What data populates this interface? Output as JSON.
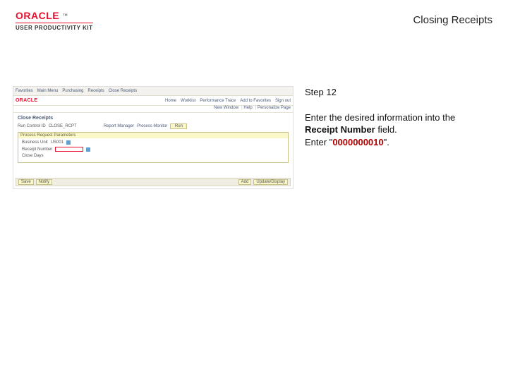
{
  "header": {
    "brand": "ORACLE",
    "tm": "™",
    "product": "USER PRODUCTIVITY KIT",
    "page_title": "Closing Receipts"
  },
  "screenshot": {
    "topbar_items": [
      "Favorites",
      "Main Menu",
      "Purchasing",
      "Receipts",
      "Close Receipts"
    ],
    "brand": "ORACLE",
    "nav_items": [
      "Home",
      "Worklist",
      "Performance Trace",
      "Add to Favorites",
      "Sign out"
    ],
    "sub_items": [
      "New Window",
      "Help",
      "Personalize Page"
    ],
    "page_heading": "Close Receipts",
    "run_control_label": "Run Control ID",
    "run_control_value": "CLOSE_RCPT",
    "report_mgr": "Report Manager",
    "process_mon": "Process Monitor",
    "run_btn": "Run",
    "panel_title": "Process Request Parameters",
    "bu_label": "Business Unit",
    "bu_value": "US001",
    "receipt_label": "Receipt Number",
    "close_days_label": "Close Days",
    "bottom_left": [
      "Save",
      "Notify"
    ],
    "bottom_right": [
      "Add",
      "Update/Display"
    ]
  },
  "instructions": {
    "step_label": "Step 12",
    "line1_a": "Enter the desired information into the ",
    "line1_field": "Receipt Number",
    "line1_b": " field.",
    "line2_a": "Enter \"",
    "line2_value": "0000000010",
    "line2_b": "\"."
  }
}
